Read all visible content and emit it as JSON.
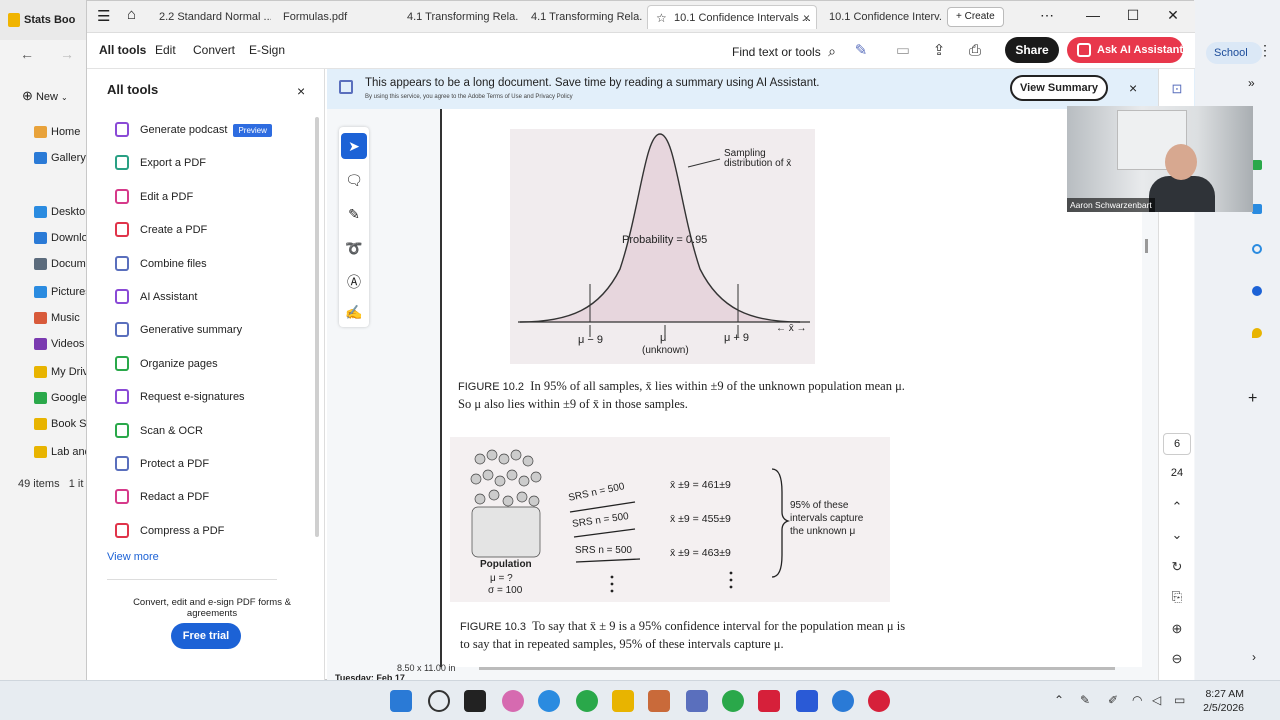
{
  "explorer": {
    "title": "Stats Boo",
    "new_label": "New",
    "items": [
      {
        "label": "Home",
        "color": "#e8a23a"
      },
      {
        "label": "Gallery",
        "color": "#2a7ad6"
      },
      {
        "label": "Desktop",
        "color": "#2a8be0"
      },
      {
        "label": "Downlo",
        "color": "#2a7ad6"
      },
      {
        "label": "Docume",
        "color": "#5b6b7c"
      },
      {
        "label": "Pictures",
        "color": "#2a8be0"
      },
      {
        "label": "Music",
        "color": "#d85a3a"
      },
      {
        "label": "Videos",
        "color": "#7a3ab0"
      },
      {
        "label": "My Drive",
        "color": "#e8b400"
      },
      {
        "label": "Google",
        "color": "#2aa84a"
      },
      {
        "label": "Book Sc",
        "color": "#e8b400"
      },
      {
        "label": "Lab and",
        "color": "#e8b400"
      }
    ],
    "status": "49 items",
    "status2": "1 it"
  },
  "tabs": [
    {
      "label": "2.2 Standard Normal ..."
    },
    {
      "label": "Formulas.pdf"
    },
    {
      "label": "4.1 Transforming Rela..."
    },
    {
      "label": "4.1 Transforming Rela..."
    },
    {
      "label": "10.1 Confidence Intervals ...",
      "close": "×"
    },
    {
      "label": "10.1 Confidence Interv..."
    }
  ],
  "create_label": "Create",
  "menu": {
    "all_tools": "All tools",
    "edit": "Edit",
    "convert": "Convert",
    "esign": "E-Sign",
    "find": "Find text or tools",
    "share": "Share",
    "ai_assistant": "Ask AI Assistant"
  },
  "tools_panel": {
    "title": "All tools",
    "close": "×",
    "tools": [
      {
        "label": "Generate podcast",
        "badge": "Preview",
        "color": "#8a4ad6"
      },
      {
        "label": "Export a PDF",
        "color": "#2aa084"
      },
      {
        "label": "Edit a PDF",
        "color": "#d63a8a"
      },
      {
        "label": "Create a PDF",
        "color": "#e0344a"
      },
      {
        "label": "Combine files",
        "color": "#5a6fbd"
      },
      {
        "label": "AI Assistant",
        "color": "#8a4ad6"
      },
      {
        "label": "Generative summary",
        "color": "#5a6fbd"
      },
      {
        "label": "Organize pages",
        "color": "#2aa84a"
      },
      {
        "label": "Request e-signatures",
        "color": "#8a4ad6"
      },
      {
        "label": "Scan & OCR",
        "color": "#2aa84a"
      },
      {
        "label": "Protect a PDF",
        "color": "#5a6fbd"
      },
      {
        "label": "Redact a PDF",
        "color": "#d63a8a"
      },
      {
        "label": "Compress a PDF",
        "color": "#e0344a"
      }
    ],
    "view_more": "View more",
    "promo": "Convert, edit and e-sign PDF forms & agreements",
    "free_trial": "Free trial"
  },
  "banner": {
    "message": "This appears to be a long document. Save time by reading a summary using AI Assistant.",
    "sub": "By using this service, you agree to the Adobe Terms of Use and Privacy Policy",
    "view_summary": "View Summary",
    "close": "×"
  },
  "document": {
    "fig1": {
      "annotation": "Sampling distribution of x̄",
      "probability": "Probability = 0.95",
      "left_label": "μ − 9",
      "center_label": "μ",
      "center_sub": "(unknown)",
      "right_label": "μ + 9",
      "axis_label": "← x̄ →"
    },
    "caption1_lead": "FIGURE 10.2",
    "caption1_line1": "In 95% of all samples, x̄ lies within ±9 of the unknown population mean μ.",
    "caption1_line2": "So μ also lies within ±9 of x̄ in those samples.",
    "fig2": {
      "population": "Population",
      "pop_mu": "μ = ?",
      "pop_sigma": "σ = 100",
      "srs": [
        "SRS n = 500",
        "SRS n = 500",
        "SRS n = 500"
      ],
      "intervals": [
        "x̄ ±9 = 461±9",
        "x̄ ±9 = 455±9",
        "x̄ ±9 = 463±9"
      ],
      "brace_text": "95% of these intervals capture the unknown μ"
    },
    "caption2_lead": "FIGURE 10.3",
    "caption2_line1": "To say that x̄ ± 9 is a 95% confidence interval for the population mean μ is",
    "caption2_line2": "to say that in repeated samples, 95% of these intervals capture μ.",
    "page_size": "8.50 x 11.00 in",
    "bottom_text": "Tuesday: Feb 17"
  },
  "page_nav": {
    "current": "6",
    "total": "24"
  },
  "video": {
    "name": "Aaron Schwarzenbart"
  },
  "edge_sidebar": {
    "school": "School"
  },
  "taskbar": {
    "time": "8:27 AM",
    "date": "2/5/2026"
  }
}
